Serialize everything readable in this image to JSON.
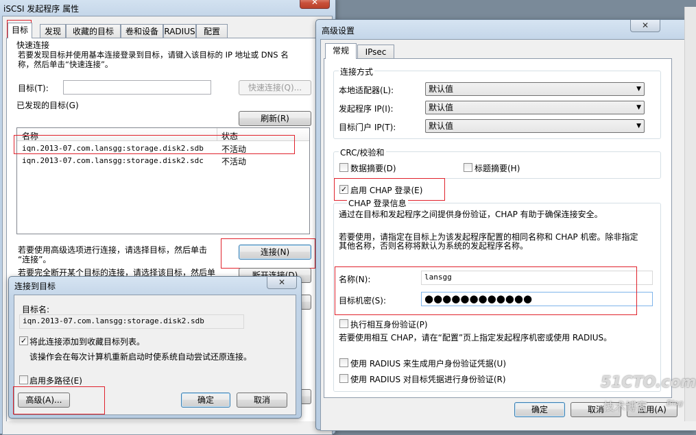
{
  "main_window": {
    "title": "iSCSI 发起程序 属性",
    "close_label": "✕",
    "tabs": [
      "目标",
      "发现",
      "收藏的目标",
      "卷和设备",
      "RADIUS",
      "配置"
    ],
    "quick_connect": {
      "header": "快速连接",
      "desc_line1": "若要发现目标并使用基本连接登录到目标，请键入该目标的 IP 地址或 DNS 名",
      "desc_line2": "称，然后单击“快速连接”。",
      "target_label": "目标(T):",
      "target_value": "",
      "quick_connect_button": "快速连接(Q)..."
    },
    "discovered": {
      "header": "已发现的目标(G)",
      "refresh_button": "刷新(R)",
      "col_name": "名称",
      "col_status": "状态",
      "rows": [
        {
          "name": "iqn.2013-07.com.lansgg:storage.disk2.sdb",
          "status": "不活动"
        },
        {
          "name": "iqn.2013-07.com.lansgg:storage.disk2.sdc",
          "status": "不活动"
        }
      ]
    },
    "advanced_text_line1": "若要使用高级选项进行连接，请选择目标，然后单击",
    "advanced_text_line2": "“连接”。",
    "connect_button": "连接(N)",
    "disconnect_text": "若要完全断开某个目标的连接，请选择该目标，然后单",
    "disconnect_button": "断开连接(D)"
  },
  "connect_dialog": {
    "title": "连接到目标",
    "close_label": "✕",
    "target_name_label": "目标名:",
    "target_name_value": "iqn.2013-07.com.lansgg:storage.disk2.sdb",
    "add_favorites_label": "将此连接添加到收藏目标列表。",
    "add_favorites_checked": true,
    "add_favorites_desc": "该操作会在每次计算机重新启动时使系统自动尝试还原连接。",
    "multipath_label": "启用多路径(E)",
    "multipath_checked": false,
    "advanced_button": "高级(A)...",
    "ok_button": "确定",
    "cancel_button": "取消"
  },
  "advanced_dialog": {
    "title": "高级设置",
    "close_label": "✕",
    "tabs": [
      "常规",
      "IPsec"
    ],
    "connect_by": {
      "header": "连接方式",
      "local_adapter_label": "本地适配器(L):",
      "local_adapter_value": "默认值",
      "initiator_ip_label": "发起程序 IP(I):",
      "initiator_ip_value": "默认值",
      "target_portal_label": "目标门户 IP(T):",
      "target_portal_value": "默认值"
    },
    "crc": {
      "header": "CRC/校验和",
      "data_digest_label": "数据摘要(D)",
      "data_digest_checked": false,
      "header_digest_label": "标题摘要(H)",
      "header_digest_checked": false
    },
    "chap": {
      "enable_label": "启用 CHAP 登录(E)",
      "enable_checked": true,
      "header": "CHAP 登录信息",
      "desc1": "通过在目标和发起程序之间提供身份验证，CHAP 有助于确保连接安全。",
      "desc2_line1": "若要使用，请指定在目标上为该发起程序配置的相同名称和 CHAP 机密。除非指定",
      "desc2_line2": "其他名称，否则名称将默认为系统的发起程序名称。",
      "name_label": "名称(N):",
      "name_value": "lansgg",
      "secret_label": "目标机密(S):",
      "secret_value": "●●●●●●●●●●●●",
      "mutual_label": "执行相互身份验证(P)",
      "mutual_checked": false,
      "mutual_desc": "若要使用相互 CHAP，请在“配置”页上指定发起程序机密或使用 RADIUS。",
      "radius_user_label": "使用 RADIUS 来生成用户身份验证凭据(U)",
      "radius_user_checked": false,
      "radius_target_label": "使用 RADIUS 对目标凭据进行身份验证(R)",
      "radius_target_checked": false
    },
    "ok_button": "确定",
    "cancel_button": "取消",
    "apply_button": "应用(A)"
  },
  "watermark": {
    "logo": "51CTO.com",
    "subtitle": "技术博客",
    "blog": "Blog"
  },
  "colors": {
    "highlight_red": "#e0202a",
    "title_bar": "#c3d5e8",
    "dialog_bg": "#f0f0f0"
  }
}
